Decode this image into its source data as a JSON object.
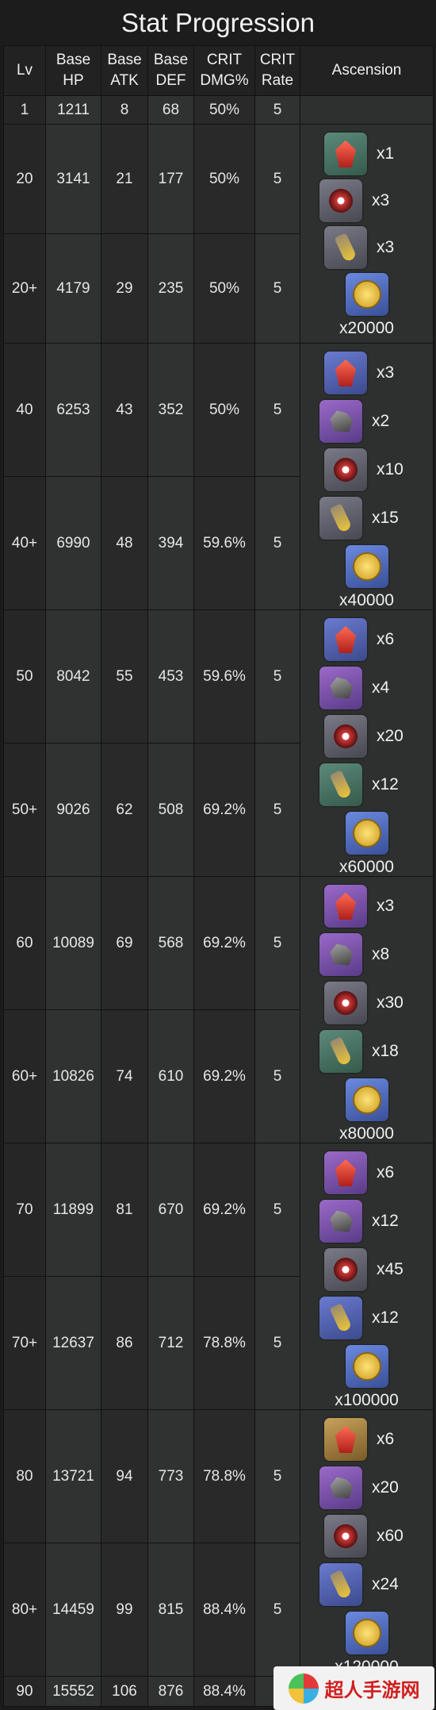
{
  "title": "Stat Progression",
  "headers": {
    "lv": "Lv",
    "hp": "Base HP",
    "atk": "Base ATK",
    "def": "Base DEF",
    "cdmg": "CRIT DMG%",
    "crate": "CRIT Rate",
    "asc": "Ascension"
  },
  "rows": [
    {
      "lv": "1",
      "hp": "1211",
      "atk": "8",
      "def": "68",
      "cdmg": "50%",
      "crate": "5"
    },
    {
      "lv": "20",
      "hp": "3141",
      "atk": "21",
      "def": "177",
      "cdmg": "50%",
      "crate": "5"
    },
    {
      "lv": "20+",
      "hp": "4179",
      "atk": "29",
      "def": "235",
      "cdmg": "50%",
      "crate": "5"
    },
    {
      "lv": "40",
      "hp": "6253",
      "atk": "43",
      "def": "352",
      "cdmg": "50%",
      "crate": "5"
    },
    {
      "lv": "40+",
      "hp": "6990",
      "atk": "48",
      "def": "394",
      "cdmg": "59.6%",
      "crate": "5"
    },
    {
      "lv": "50",
      "hp": "8042",
      "atk": "55",
      "def": "453",
      "cdmg": "59.6%",
      "crate": "5"
    },
    {
      "lv": "50+",
      "hp": "9026",
      "atk": "62",
      "def": "508",
      "cdmg": "69.2%",
      "crate": "5"
    },
    {
      "lv": "60",
      "hp": "10089",
      "atk": "69",
      "def": "568",
      "cdmg": "69.2%",
      "crate": "5"
    },
    {
      "lv": "60+",
      "hp": "10826",
      "atk": "74",
      "def": "610",
      "cdmg": "69.2%",
      "crate": "5"
    },
    {
      "lv": "70",
      "hp": "11899",
      "atk": "81",
      "def": "670",
      "cdmg": "69.2%",
      "crate": "5"
    },
    {
      "lv": "70+",
      "hp": "12637",
      "atk": "86",
      "def": "712",
      "cdmg": "78.8%",
      "crate": "5"
    },
    {
      "lv": "80",
      "hp": "13721",
      "atk": "94",
      "def": "773",
      "cdmg": "78.8%",
      "crate": "5"
    },
    {
      "lv": "80+",
      "hp": "14459",
      "atk": "99",
      "def": "815",
      "cdmg": "88.4%",
      "crate": "5"
    },
    {
      "lv": "90",
      "hp": "15552",
      "atk": "106",
      "def": "876",
      "cdmg": "88.4%",
      "crate": "5"
    }
  ],
  "ascension": [
    {
      "materials": [
        {
          "icon": "red-crystal-icon",
          "bg": "green",
          "qty": "x1"
        },
        {
          "icon": "red-flower-icon",
          "bg": "gray",
          "qty": "x3"
        },
        {
          "icon": "vial-icon",
          "bg": "gray",
          "qty": "x3"
        }
      ],
      "mora": {
        "icon": "mora-coin-icon",
        "qty": "x20000"
      }
    },
    {
      "materials": [
        {
          "icon": "red-crystal-icon",
          "bg": "blue",
          "qty": "x3"
        },
        {
          "icon": "gray-rock-icon",
          "bg": "purple",
          "qty": "x2"
        },
        {
          "icon": "red-flower-icon",
          "bg": "gray",
          "qty": "x10"
        },
        {
          "icon": "vial-icon",
          "bg": "gray",
          "qty": "x15"
        }
      ],
      "mora": {
        "icon": "mora-coin-icon",
        "qty": "x40000"
      }
    },
    {
      "materials": [
        {
          "icon": "red-crystal-icon",
          "bg": "blue",
          "qty": "x6"
        },
        {
          "icon": "gray-rock-icon",
          "bg": "purple",
          "qty": "x4"
        },
        {
          "icon": "red-flower-icon",
          "bg": "gray",
          "qty": "x20"
        },
        {
          "icon": "vial-icon",
          "bg": "green",
          "qty": "x12"
        }
      ],
      "mora": {
        "icon": "mora-coin-icon",
        "qty": "x60000"
      }
    },
    {
      "materials": [
        {
          "icon": "red-crystal-icon",
          "bg": "purple",
          "qty": "x3"
        },
        {
          "icon": "gray-rock-icon",
          "bg": "purple",
          "qty": "x8"
        },
        {
          "icon": "red-flower-icon",
          "bg": "gray",
          "qty": "x30"
        },
        {
          "icon": "vial-icon",
          "bg": "green",
          "qty": "x18"
        }
      ],
      "mora": {
        "icon": "mora-coin-icon",
        "qty": "x80000"
      }
    },
    {
      "materials": [
        {
          "icon": "red-crystal-icon",
          "bg": "purple",
          "qty": "x6"
        },
        {
          "icon": "gray-rock-icon",
          "bg": "purple",
          "qty": "x12"
        },
        {
          "icon": "red-flower-icon",
          "bg": "gray",
          "qty": "x45"
        },
        {
          "icon": "vial-icon",
          "bg": "blue",
          "qty": "x12"
        }
      ],
      "mora": {
        "icon": "mora-coin-icon",
        "qty": "x100000"
      }
    },
    {
      "materials": [
        {
          "icon": "red-crystal-icon",
          "bg": "gold",
          "qty": "x6"
        },
        {
          "icon": "gray-rock-icon",
          "bg": "purple",
          "qty": "x20"
        },
        {
          "icon": "red-flower-icon",
          "bg": "gray",
          "qty": "x60"
        },
        {
          "icon": "vial-icon",
          "bg": "blue",
          "qty": "x24"
        }
      ],
      "mora": {
        "icon": "mora-coin-icon",
        "qty": "x120000"
      }
    }
  ],
  "watermark": {
    "text": "超人手游网"
  }
}
